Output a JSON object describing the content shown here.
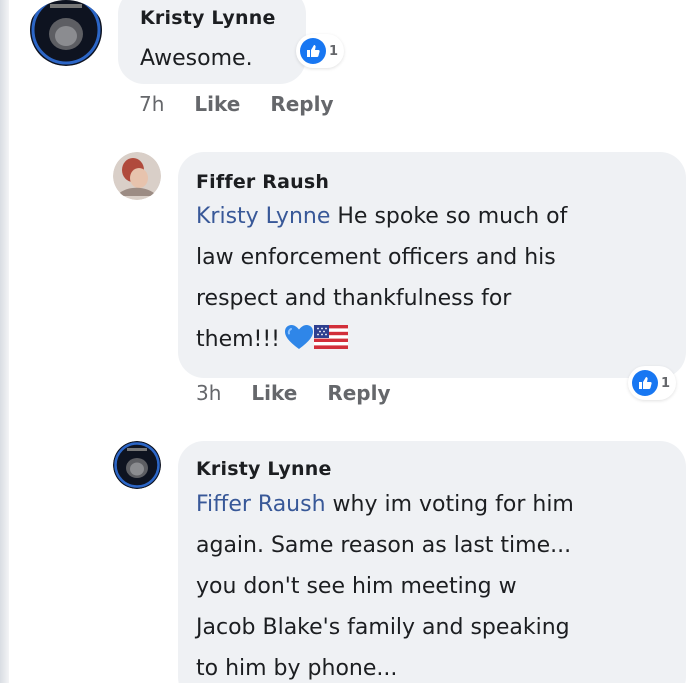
{
  "comments": [
    {
      "author": "Kristy Lynne",
      "lines": [
        "Awesome."
      ],
      "reaction_count": "1",
      "time": "7h",
      "like_label": "Like",
      "reply_label": "Reply"
    },
    {
      "author": "Fiffer Raush",
      "mention": "Kristy Lynne",
      "lines": [
        " He spoke so much of",
        "law enforcement officers and his",
        "respect and thankfulness for",
        "them!!!"
      ],
      "emojis": [
        "blue-heart-icon",
        "us-flag-icon"
      ],
      "reaction_count": "1",
      "time": "3h",
      "like_label": "Like",
      "reply_label": "Reply"
    },
    {
      "author": "Kristy Lynne",
      "mention": "Fiffer Raush",
      "lines": [
        " why im voting for him",
        "again. Same reason as last time...",
        "you don't see him meeting w",
        "Jacob Blake's family and speaking",
        "to him by phone..."
      ]
    }
  ],
  "colors": {
    "bubble": "#eff1f4",
    "mention": "#385898",
    "like_blue": "#1877f2",
    "meta": "#65676b"
  }
}
